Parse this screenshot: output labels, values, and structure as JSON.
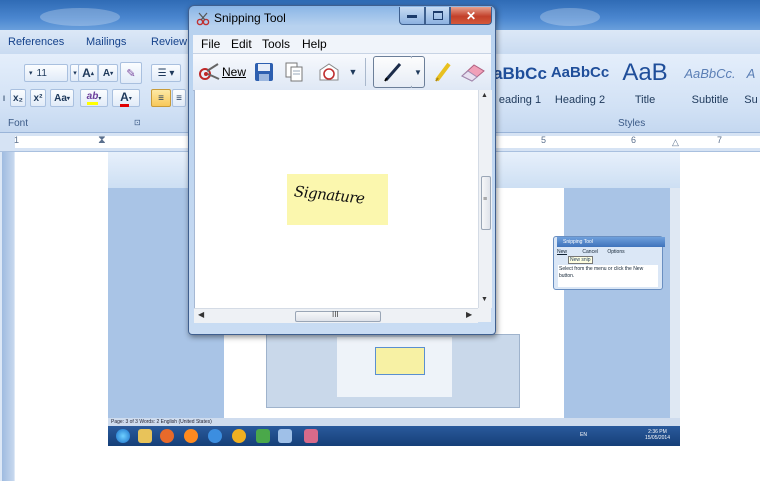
{
  "word": {
    "tabs": [
      "References",
      "Mailings",
      "Review"
    ],
    "font": {
      "size": "11",
      "grow_label": "A",
      "shrink_label": "A",
      "subscript": "x₂",
      "superscript": "x²",
      "change_case": "Aa",
      "highlight": "ab",
      "font_color": "A",
      "group_label": "Font"
    },
    "styles": {
      "items": [
        {
          "sample": "aBbCс",
          "name": "eading 1"
        },
        {
          "sample": "AaBbCc",
          "name": "Heading 2"
        },
        {
          "sample": "AaB",
          "name": "Title"
        },
        {
          "sample": "AaBbCc.",
          "name": "Subtitle"
        },
        {
          "sample": "A",
          "name": "Su"
        }
      ],
      "group_label": "Styles"
    },
    "ruler_marks": [
      "1",
      "5",
      "6",
      "7"
    ]
  },
  "snipping_tool": {
    "title": "Snipping Tool",
    "menu": [
      "File",
      "Edit",
      "Tools",
      "Help"
    ],
    "new_label": "New",
    "hscroll_grip": "III",
    "signature_text": "Signature"
  },
  "captured": {
    "mini_window": {
      "title": "Snipping Tool",
      "new_label": "New",
      "cancel_label": "Cancel",
      "options_label": "Options",
      "tooltip": "New snip",
      "hint": "Select from the menu or click the New button."
    },
    "status_text": "Page: 3 of 3   Words: 2   English (United States)",
    "clock": {
      "time": "2:36 PM",
      "date": "15/05/2014"
    },
    "tray": "EN"
  }
}
